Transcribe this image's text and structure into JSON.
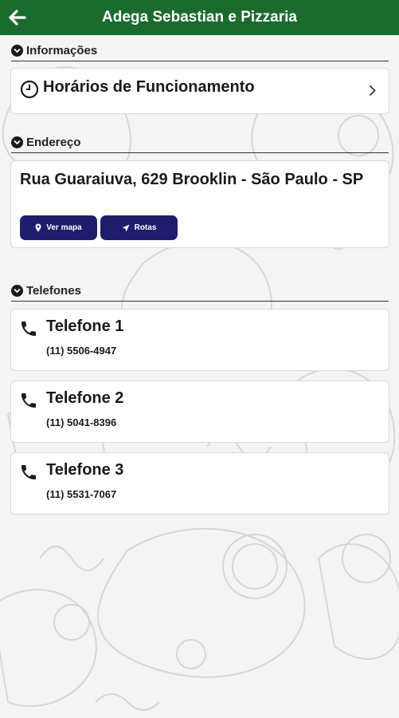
{
  "header": {
    "title": "Adega Sebastian e Pizzaria",
    "back_icon": "arrow-left-icon"
  },
  "sections": {
    "info": {
      "title": "Informações"
    },
    "address": {
      "title": "Endereço"
    },
    "phones": {
      "title": "Telefones"
    }
  },
  "hours": {
    "label": "Horários de Funcionamento",
    "icon": "clock-icon"
  },
  "address": {
    "text": "Rua Guaraiuva, 629 Brooklin - São Paulo - SP",
    "map_button": "Ver mapa",
    "route_button": "Rotas"
  },
  "phones": [
    {
      "name": "Telefone 1",
      "number": "(11) 5506-4947"
    },
    {
      "name": "Telefone 2",
      "number": "(11) 5041-8396"
    },
    {
      "name": "Telefone 3",
      "number": "(11) 5531-7067"
    }
  ],
  "colors": {
    "header": "#1b6b2f",
    "button": "#1f1d6b",
    "background": "#f4f4f4"
  }
}
